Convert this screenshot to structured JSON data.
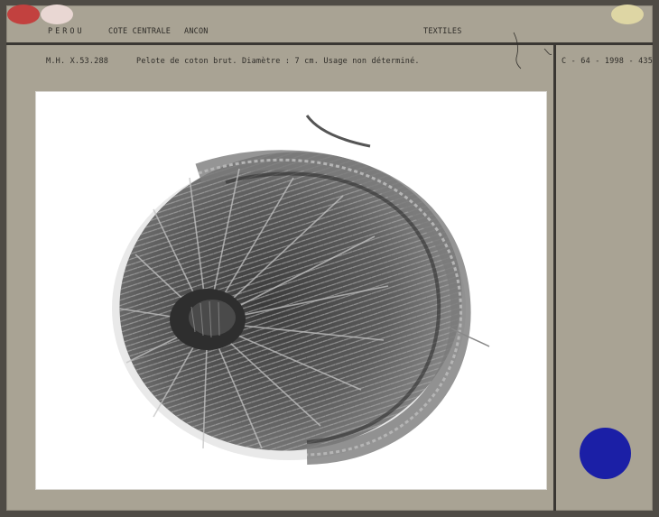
{
  "header": {
    "country": "PEROU",
    "region": "COTE CENTRALE",
    "site": "ANCON",
    "category": "TEXTILES"
  },
  "record": {
    "inventory": "M.H. X.53.288",
    "description": "Pelote de coton brut. Diamètre : 7 cm. Usage non déterminé.",
    "reference": "C - 64 - 1998 - 435"
  },
  "colors": {
    "card": "#a9a394",
    "red_dot": "#c2413f",
    "pink_dot": "#e9d7d3",
    "yellow_dot": "#ded6a4",
    "blue_dot": "#1b1fa6"
  }
}
